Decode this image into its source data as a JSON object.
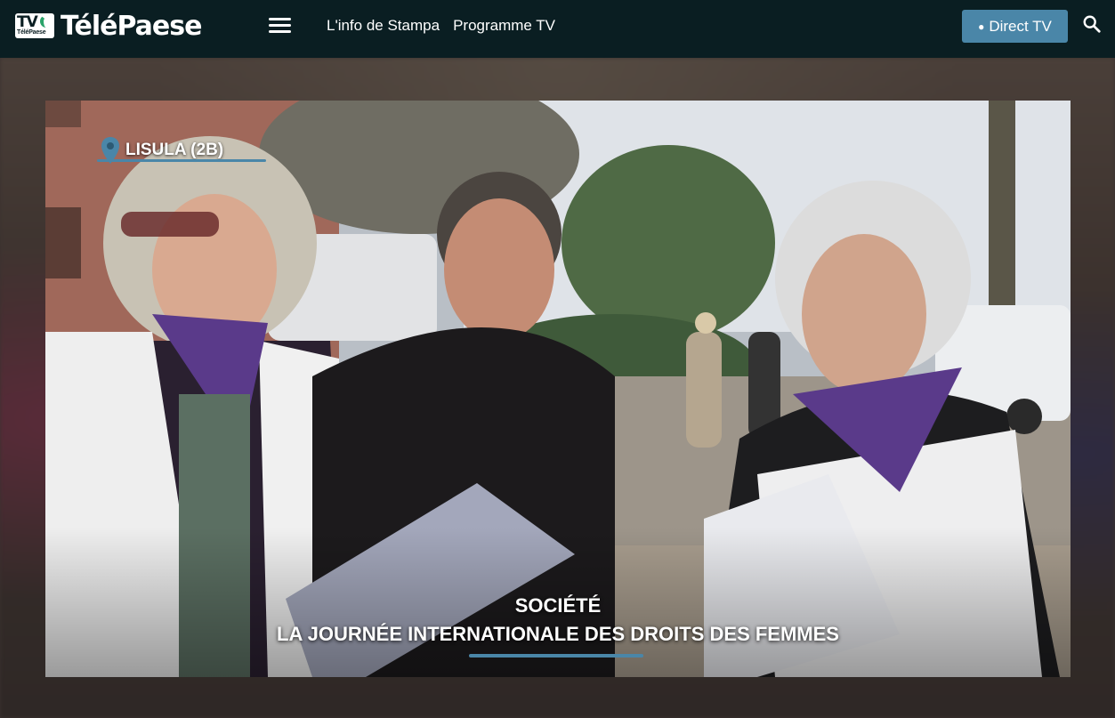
{
  "header": {
    "logo_badge": "TV",
    "logo_badge_small": "TéléPaese",
    "logo_text": "TéléPaese",
    "nav": [
      {
        "label": "L'info de Stampa"
      },
      {
        "label": "Programme TV"
      }
    ],
    "direct_button": {
      "dot": "●",
      "label": "Direct TV"
    },
    "icons": {
      "menu": "hamburger-menu-icon",
      "search": "search-icon"
    }
  },
  "hero": {
    "location": "LISULA (2B)",
    "category": "SOCIÉTÉ",
    "headline": "LA JOURNÉE INTERNATIONALE DES DROITS DES FEMMES"
  },
  "colors": {
    "header_bg": "#0a1e22",
    "accent": "#4a86a8"
  }
}
